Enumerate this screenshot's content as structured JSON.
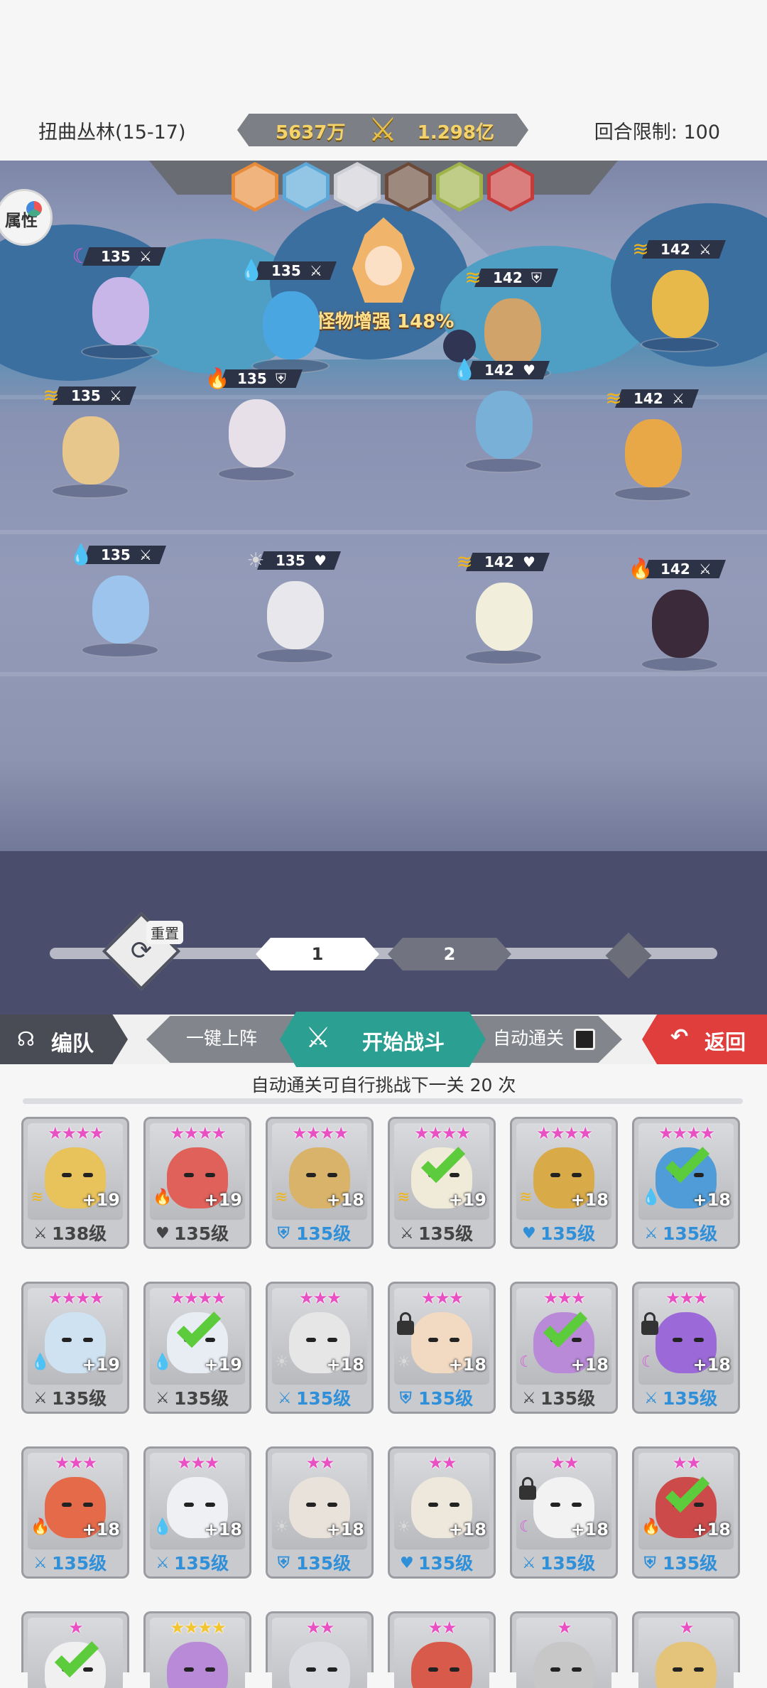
{
  "header": {
    "stage_name": "扭曲丛林(15-17)",
    "power_left": "5637万",
    "power_right": "1.298亿",
    "turn_limit": "回合限制: 100"
  },
  "scene": {
    "attr_label": "属性",
    "boss_label": "怪物增强 148%",
    "enemy_portraits": [
      "#e98c3a",
      "#5aa7d8",
      "#cfcfd6",
      "#6b4a3a",
      "#9fb34a",
      "#c73a3a"
    ],
    "player_units": [
      {
        "element": "moon",
        "level": "135",
        "class": "sword"
      },
      {
        "element": "water",
        "level": "135",
        "class": "sword"
      },
      {
        "element": "thunder",
        "level": "135",
        "class": "sword"
      },
      {
        "element": "fire",
        "level": "135",
        "class": "shield"
      },
      {
        "element": "water",
        "level": "135",
        "class": "sword"
      },
      {
        "element": "light",
        "level": "135",
        "class": "heart"
      }
    ],
    "enemy_units": [
      {
        "element": "thunder",
        "level": "142",
        "class": "sword"
      },
      {
        "element": "thunder",
        "level": "142",
        "class": "shield"
      },
      {
        "element": "water",
        "level": "142",
        "class": "heart"
      },
      {
        "element": "thunder",
        "level": "142",
        "class": "sword"
      },
      {
        "element": "thunder",
        "level": "142",
        "class": "heart"
      },
      {
        "element": "fire",
        "level": "142",
        "class": "sword"
      }
    ],
    "reset_label": "重置",
    "waves": [
      "1",
      "2"
    ]
  },
  "actions": {
    "team_label": "编队",
    "deploy_label": "一键上阵",
    "start_label": "开始战斗",
    "auto_label": "自动通关",
    "back_label": "返回"
  },
  "auto_info": "自动通关可自行挑战下一关 20 次",
  "roster": [
    {
      "stars": "★★★★",
      "element": "thunder",
      "plus": "+19",
      "level": "138级",
      "class": "sword",
      "blue": false,
      "checked": false,
      "locked": false,
      "color": "#e8c25a"
    },
    {
      "stars": "★★★★",
      "element": "fire",
      "plus": "+19",
      "level": "135级",
      "class": "heart",
      "blue": false,
      "checked": false,
      "locked": false,
      "color": "#e0605a"
    },
    {
      "stars": "★★★★",
      "element": "thunder",
      "plus": "+18",
      "level": "135级",
      "class": "shield",
      "blue": true,
      "checked": false,
      "locked": false,
      "color": "#d9b36a"
    },
    {
      "stars": "★★★★",
      "element": "thunder",
      "plus": "+19",
      "level": "135级",
      "class": "sword",
      "blue": false,
      "checked": true,
      "locked": false,
      "color": "#f0ead8"
    },
    {
      "stars": "★★★★",
      "element": "thunder",
      "plus": "+18",
      "level": "135级",
      "class": "heart",
      "blue": true,
      "checked": false,
      "locked": false,
      "color": "#d8aa48"
    },
    {
      "stars": "★★★★",
      "element": "water",
      "plus": "+18",
      "level": "135级",
      "class": "sword",
      "blue": true,
      "checked": true,
      "locked": false,
      "color": "#4f9cd8"
    },
    {
      "stars": "★★★★",
      "element": "water",
      "plus": "+19",
      "level": "135级",
      "class": "sword",
      "blue": false,
      "checked": false,
      "locked": false,
      "color": "#cfe2f2"
    },
    {
      "stars": "★★★★",
      "element": "water",
      "plus": "+19",
      "level": "135级",
      "class": "sword",
      "blue": false,
      "checked": true,
      "locked": false,
      "color": "#e8edf4"
    },
    {
      "stars": "★★★",
      "element": "light",
      "plus": "+18",
      "level": "135级",
      "class": "sword",
      "blue": true,
      "checked": false,
      "locked": false,
      "color": "#e6e6e6"
    },
    {
      "stars": "★★★",
      "element": "light",
      "plus": "+18",
      "level": "135级",
      "class": "shield",
      "blue": true,
      "checked": false,
      "locked": true,
      "color": "#f1d9c2"
    },
    {
      "stars": "★★★",
      "element": "moon",
      "plus": "+18",
      "level": "135级",
      "class": "sword",
      "blue": false,
      "checked": true,
      "locked": false,
      "color": "#b98ad8"
    },
    {
      "stars": "★★★",
      "element": "moon",
      "plus": "+18",
      "level": "135级",
      "class": "sword",
      "blue": true,
      "checked": false,
      "locked": true,
      "color": "#9b6ad8"
    },
    {
      "stars": "★★★",
      "element": "fire",
      "plus": "+18",
      "level": "135级",
      "class": "sword",
      "blue": true,
      "checked": false,
      "locked": false,
      "color": "#e46a4a"
    },
    {
      "stars": "★★★",
      "element": "water",
      "plus": "+18",
      "level": "135级",
      "class": "sword",
      "blue": true,
      "checked": false,
      "locked": false,
      "color": "#eef0f4"
    },
    {
      "stars": "★★",
      "element": "light",
      "plus": "+18",
      "level": "135级",
      "class": "shield",
      "blue": true,
      "checked": false,
      "locked": false,
      "color": "#e8e2da"
    },
    {
      "stars": "★★",
      "element": "light",
      "plus": "+18",
      "level": "135级",
      "class": "heart",
      "blue": true,
      "checked": false,
      "locked": false,
      "color": "#eee8dc"
    },
    {
      "stars": "★★",
      "element": "moon",
      "plus": "+18",
      "level": "135级",
      "class": "sword",
      "blue": true,
      "checked": false,
      "locked": true,
      "color": "#f2f2f2"
    },
    {
      "stars": "★★",
      "element": "fire",
      "plus": "+18",
      "level": "135级",
      "class": "shield",
      "blue": true,
      "checked": true,
      "locked": false,
      "color": "#cc4a4a"
    },
    {
      "stars": "★",
      "element": "",
      "plus": "",
      "level": "",
      "class": "",
      "blue": false,
      "checked": true,
      "locked": false,
      "color": "#f0f0f0"
    },
    {
      "stars": "★★★★",
      "element": "",
      "plus": "",
      "level": "",
      "class": "",
      "blue": false,
      "checked": false,
      "locked": false,
      "color": "#b88ad8",
      "gold": true
    },
    {
      "stars": "★★",
      "element": "",
      "plus": "",
      "level": "",
      "class": "",
      "blue": false,
      "checked": false,
      "locked": false,
      "color": "#d9dbe0"
    },
    {
      "stars": "★★",
      "element": "",
      "plus": "",
      "level": "",
      "class": "",
      "blue": false,
      "checked": false,
      "locked": false,
      "color": "#d85a4a"
    },
    {
      "stars": "★",
      "element": "",
      "plus": "",
      "level": "",
      "class": "",
      "blue": false,
      "checked": false,
      "locked": false,
      "color": "#c7c7c7"
    },
    {
      "stars": "★",
      "element": "",
      "plus": "",
      "level": "",
      "class": "",
      "blue": false,
      "checked": false,
      "locked": false,
      "color": "#e4c47a"
    }
  ]
}
